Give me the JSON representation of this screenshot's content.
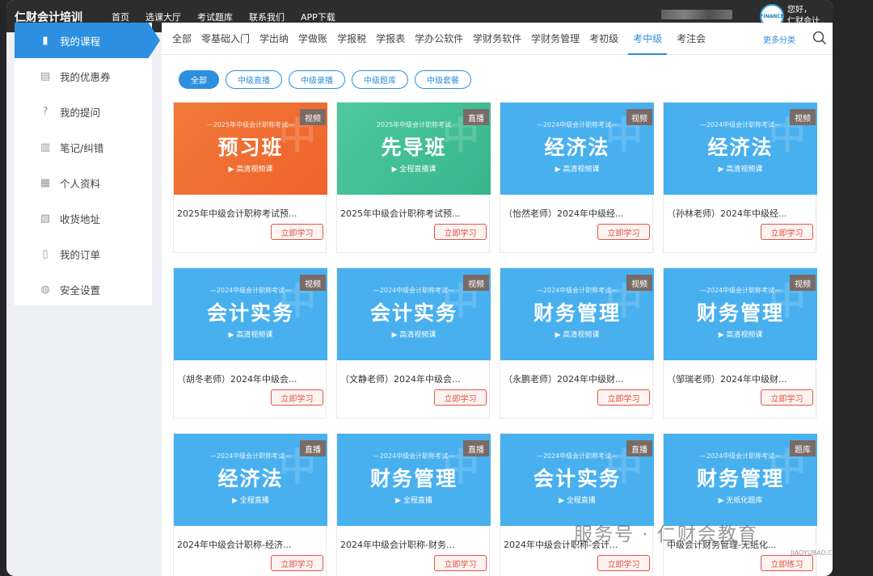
{
  "header": {
    "brand": "仁财会计培训",
    "nav": [
      "首页",
      "选课大厅",
      "考试题库",
      "联系我们",
      "APP下载"
    ],
    "greeting": "您好，",
    "username": "仁财会计...",
    "avatar_text": "FINANCE"
  },
  "sidebar": {
    "items": [
      {
        "label": "我的课程",
        "icon": "book-icon"
      },
      {
        "label": "我的优惠券",
        "icon": "coupon-icon"
      },
      {
        "label": "我的提问",
        "icon": "question-icon"
      },
      {
        "label": "笔记/纠错",
        "icon": "note-icon"
      },
      {
        "label": "个人资料",
        "icon": "profile-icon"
      },
      {
        "label": "收货地址",
        "icon": "address-icon"
      },
      {
        "label": "我的订单",
        "icon": "order-icon"
      },
      {
        "label": "安全设置",
        "icon": "security-icon"
      }
    ]
  },
  "tabs": {
    "items": [
      "全部",
      "零基础入门",
      "学出纳",
      "学做账",
      "学报税",
      "学报表",
      "学办公软件",
      "学财务软件",
      "学财务管理",
      "考初级",
      "考中级",
      "考注会"
    ],
    "active": "考中级",
    "more": "更多分类"
  },
  "filters": [
    "全部",
    "中级直播",
    "中级录播",
    "中级题库",
    "中级套餐"
  ],
  "courses": [
    {
      "sub": "—2025年中级会计职称考试—",
      "title": "预习班",
      "play": "高清视频课",
      "badge": "视频",
      "name": "2025年中级会计职称考试预...",
      "btn": "立即学习",
      "theme": "orange"
    },
    {
      "sub": "2025年中级会计职称考试",
      "title": "先导班",
      "play": "全程直播课",
      "badge": "直播",
      "name": "2025年中级会计职称考试预...",
      "btn": "立即学习",
      "theme": "green"
    },
    {
      "sub": "—2024中级会计职称考试—",
      "title": "经济法",
      "play": "高清视频课",
      "badge": "视频",
      "name": "（怡然老师）2024年中级经...",
      "btn": "立即学习",
      "theme": "blue"
    },
    {
      "sub": "—2024中级会计职称考试—",
      "title": "经济法",
      "play": "高清视频课",
      "badge": "视频",
      "name": "（孙林老师）2024年中级经...",
      "btn": "立即学习",
      "theme": "blue"
    },
    {
      "sub": "—2024中级会计职称考试—",
      "title": "会计实务",
      "play": "高清视频课",
      "badge": "视频",
      "name": "（胡冬老师）2024年中级会...",
      "btn": "立即学习",
      "theme": "blue"
    },
    {
      "sub": "—2024中级会计职称考试—",
      "title": "会计实务",
      "play": "高清视频课",
      "badge": "视频",
      "name": "（文静老师）2024年中级会...",
      "btn": "立即学习",
      "theme": "blue"
    },
    {
      "sub": "—2024中级会计职称考试—",
      "title": "财务管理",
      "play": "高清视频课",
      "badge": "视频",
      "name": "（永鹏老师）2024年中级财...",
      "btn": "立即学习",
      "theme": "blue"
    },
    {
      "sub": "—2024中级会计职称考试—",
      "title": "财务管理",
      "play": "高清视频课",
      "badge": "视频",
      "name": "（邹瑞老师）2024年中级财...",
      "btn": "立即学习",
      "theme": "blue"
    },
    {
      "sub": "—2024中级会计职称考试—",
      "title": "经济法",
      "play": "全程直播",
      "badge": "直播",
      "name": "2024年中级会计职称-经济...",
      "btn": "立即学习",
      "theme": "blue"
    },
    {
      "sub": "—2024中级会计职称考试—",
      "title": "财务管理",
      "play": "全程直播",
      "badge": "直播",
      "name": "2024年中级会计职称-财务...",
      "btn": "立即学习",
      "theme": "blue"
    },
    {
      "sub": "—2024中级会计职称考试—",
      "title": "会计实务",
      "play": "全程直播",
      "badge": "直播",
      "name": "2024年中级会计职称-会计...",
      "btn": "立即学习",
      "theme": "blue"
    },
    {
      "sub": "—2024中级会计职称考试—",
      "title": "财务管理",
      "play": "无纸化题库",
      "badge": "题库",
      "name": "中级会计财务管理-无纸化...",
      "btn": "立即练习",
      "theme": "blue"
    }
  ],
  "watermark": {
    "text": "服务号 · 仁财会教育",
    "sub": "JIAOYUBAO.CN"
  }
}
